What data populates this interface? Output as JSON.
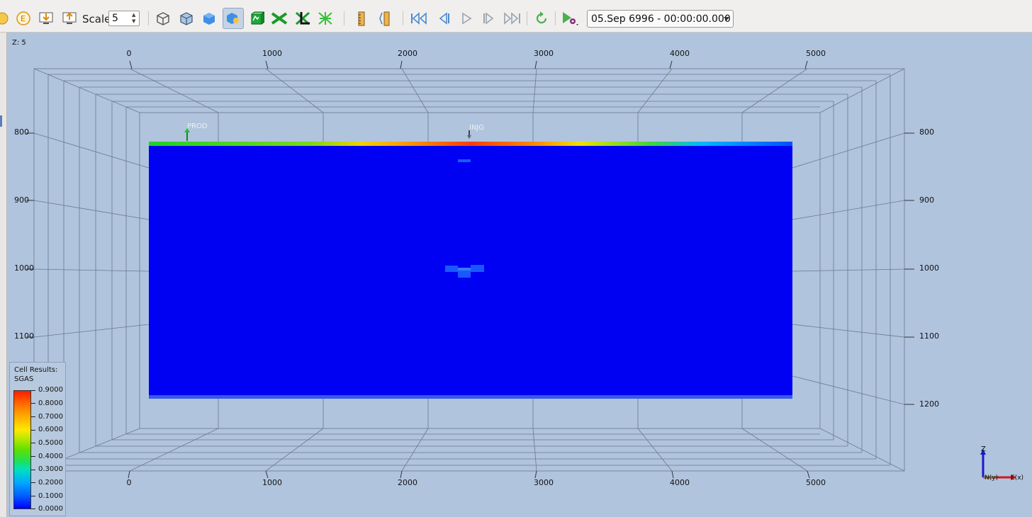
{
  "toolbar": {
    "scale_label": "Scale",
    "scale_value": "5",
    "time_step": "05.Sep 6996 - 00:00:00.000",
    "icons": [
      "info-icon",
      "export-icon",
      "snapshot-to-file-icon",
      "snapshot-to-clipboard-icon",
      "wireframe-icon",
      "surface-icon",
      "solid-icon",
      "faults-icon",
      "cell-edges-icon",
      "cross-section-icon",
      "well-path-icon",
      "tree-icon",
      "vertical-ruler-icon",
      "vertical-ruler-2-icon",
      "skip-to-start-icon",
      "step-back-icon",
      "play-icon",
      "step-forward-icon",
      "skip-to-end-icon",
      "restart-icon",
      "settings-icon"
    ]
  },
  "view": {
    "z_label": "Z: 5",
    "top_ticks": [
      "0",
      "1000",
      "2000",
      "3000",
      "4000",
      "5000"
    ],
    "bottom_ticks": [
      "0",
      "1000",
      "2000",
      "3000",
      "4000",
      "5000"
    ],
    "left_ticks": [
      "800",
      "900",
      "1000",
      "1100"
    ],
    "right_ticks": [
      "800",
      "900",
      "1000",
      "1100",
      "1200"
    ],
    "wells": {
      "producer": "PROD",
      "injector": "INJG"
    }
  },
  "legend": {
    "title_line1": "Cell Results:",
    "title_line2": "SGAS",
    "labels": [
      "0.9000",
      "0.8000",
      "0.7000",
      "0.6000",
      "0.5000",
      "0.4000",
      "0.3000",
      "0.2000",
      "0.1000",
      "0.0000"
    ]
  },
  "axes": {
    "z": "Z",
    "n": "N(y)",
    "e": "E(x)"
  },
  "colors": {
    "background": "#b0c4de",
    "field": "#0000f4",
    "accent": "#4a90d9"
  }
}
